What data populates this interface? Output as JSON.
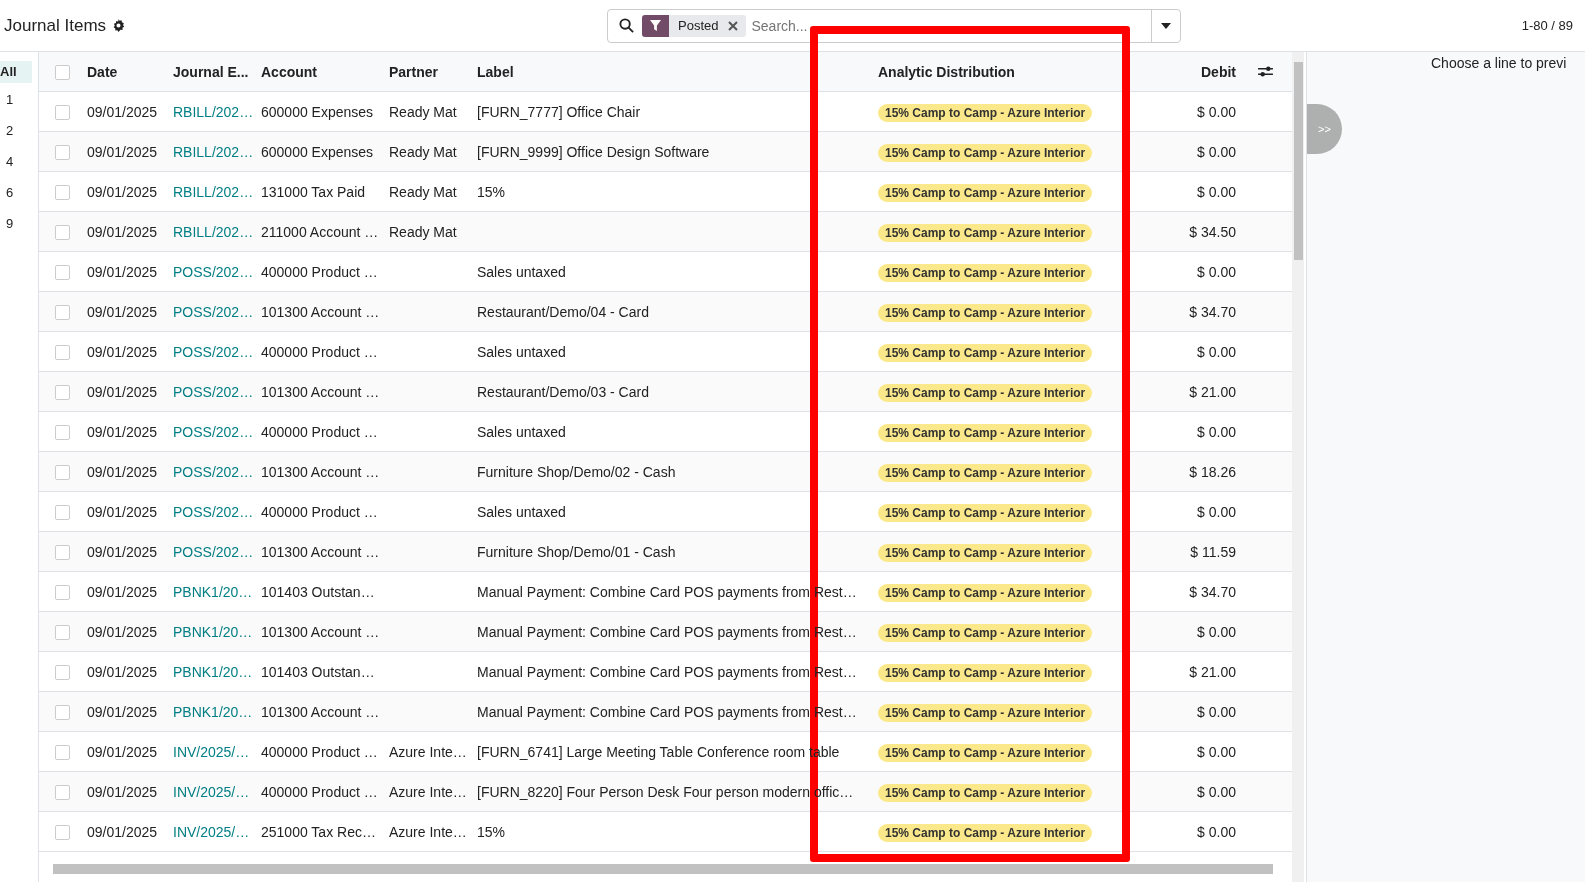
{
  "title": "Journal Items",
  "search": {
    "facet": "Posted",
    "placeholder": "Search..."
  },
  "pager": "1-80 / 89",
  "groups": [
    {
      "label": "All",
      "selected": true
    },
    {
      "label": "1",
      "selected": false
    },
    {
      "label": "2",
      "selected": false
    },
    {
      "label": "4",
      "selected": false
    },
    {
      "label": "6",
      "selected": false
    },
    {
      "label": "9",
      "selected": false
    }
  ],
  "select_all_checked": false,
  "columns": [
    "Date",
    "Journal E...",
    "Account",
    "Partner",
    "Label",
    "Analytic Distribution",
    "Debit"
  ],
  "rows": [
    {
      "checked": false,
      "date": "09/01/2025",
      "journal": "RBILL/202…",
      "account": "600000 Expenses",
      "partner": "Ready Mat",
      "label": "[FURN_7777] Office Chair",
      "analytic": "15% Camp to Camp - Azure Interior",
      "debit": "$ 0.00"
    },
    {
      "checked": false,
      "date": "09/01/2025",
      "journal": "RBILL/202…",
      "account": "600000 Expenses",
      "partner": "Ready Mat",
      "label": "[FURN_9999] Office Design Software",
      "analytic": "15% Camp to Camp - Azure Interior",
      "debit": "$ 0.00"
    },
    {
      "checked": false,
      "date": "09/01/2025",
      "journal": "RBILL/202…",
      "account": "131000 Tax Paid",
      "partner": "Ready Mat",
      "label": "15%",
      "analytic": "15% Camp to Camp - Azure Interior",
      "debit": "$ 0.00"
    },
    {
      "checked": false,
      "date": "09/01/2025",
      "journal": "RBILL/202…",
      "account": "211000 Account …",
      "partner": "Ready Mat",
      "label": "",
      "analytic": "15% Camp to Camp - Azure Interior",
      "debit": "$ 34.50"
    },
    {
      "checked": false,
      "date": "09/01/2025",
      "journal": "POSS/202…",
      "account": "400000 Product …",
      "partner": "",
      "label": "Sales untaxed",
      "analytic": "15% Camp to Camp - Azure Interior",
      "debit": "$ 0.00"
    },
    {
      "checked": false,
      "date": "09/01/2025",
      "journal": "POSS/202…",
      "account": "101300 Account …",
      "partner": "",
      "label": "Restaurant/Demo/04 - Card",
      "analytic": "15% Camp to Camp - Azure Interior",
      "debit": "$ 34.70"
    },
    {
      "checked": false,
      "date": "09/01/2025",
      "journal": "POSS/202…",
      "account": "400000 Product …",
      "partner": "",
      "label": "Sales untaxed",
      "analytic": "15% Camp to Camp - Azure Interior",
      "debit": "$ 0.00"
    },
    {
      "checked": false,
      "date": "09/01/2025",
      "journal": "POSS/202…",
      "account": "101300 Account …",
      "partner": "",
      "label": "Restaurant/Demo/03 - Card",
      "analytic": "15% Camp to Camp - Azure Interior",
      "debit": "$ 21.00"
    },
    {
      "checked": false,
      "date": "09/01/2025",
      "journal": "POSS/202…",
      "account": "400000 Product …",
      "partner": "",
      "label": "Sales untaxed",
      "analytic": "15% Camp to Camp - Azure Interior",
      "debit": "$ 0.00"
    },
    {
      "checked": false,
      "date": "09/01/2025",
      "journal": "POSS/202…",
      "account": "101300 Account …",
      "partner": "",
      "label": "Furniture Shop/Demo/02 - Cash",
      "analytic": "15% Camp to Camp - Azure Interior",
      "debit": "$ 18.26"
    },
    {
      "checked": false,
      "date": "09/01/2025",
      "journal": "POSS/202…",
      "account": "400000 Product …",
      "partner": "",
      "label": "Sales untaxed",
      "analytic": "15% Camp to Camp - Azure Interior",
      "debit": "$ 0.00"
    },
    {
      "checked": false,
      "date": "09/01/2025",
      "journal": "POSS/202…",
      "account": "101300 Account …",
      "partner": "",
      "label": "Furniture Shop/Demo/01 - Cash",
      "analytic": "15% Camp to Camp - Azure Interior",
      "debit": "$ 11.59"
    },
    {
      "checked": false,
      "date": "09/01/2025",
      "journal": "PBNK1/20…",
      "account": "101403 Outstan…",
      "partner": "",
      "label": "Manual Payment: Combine Card POS payments from Rest…",
      "analytic": "15% Camp to Camp - Azure Interior",
      "debit": "$ 34.70"
    },
    {
      "checked": false,
      "date": "09/01/2025",
      "journal": "PBNK1/20…",
      "account": "101300 Account …",
      "partner": "",
      "label": "Manual Payment: Combine Card POS payments from Rest…",
      "analytic": "15% Camp to Camp - Azure Interior",
      "debit": "$ 0.00"
    },
    {
      "checked": false,
      "date": "09/01/2025",
      "journal": "PBNK1/20…",
      "account": "101403 Outstan…",
      "partner": "",
      "label": "Manual Payment: Combine Card POS payments from Rest…",
      "analytic": "15% Camp to Camp - Azure Interior",
      "debit": "$ 21.00"
    },
    {
      "checked": false,
      "date": "09/01/2025",
      "journal": "PBNK1/20…",
      "account": "101300 Account …",
      "partner": "",
      "label": "Manual Payment: Combine Card POS payments from Rest…",
      "analytic": "15% Camp to Camp - Azure Interior",
      "debit": "$ 0.00"
    },
    {
      "checked": false,
      "date": "09/01/2025",
      "journal": "INV/2025/…",
      "account": "400000 Product …",
      "partner": "Azure Inte…",
      "label": "[FURN_6741] Large Meeting Table Conference room table",
      "analytic": "15% Camp to Camp - Azure Interior",
      "debit": "$ 0.00"
    },
    {
      "checked": false,
      "date": "09/01/2025",
      "journal": "INV/2025/…",
      "account": "400000 Product …",
      "partner": "Azure Inte…",
      "label": "[FURN_8220] Four Person Desk Four person modern offic…",
      "analytic": "15% Camp to Camp - Azure Interior",
      "debit": "$ 0.00"
    },
    {
      "checked": false,
      "date": "09/01/2025",
      "journal": "INV/2025/…",
      "account": "251000 Tax Rec…",
      "partner": "Azure Inte…",
      "label": "15%",
      "analytic": "15% Camp to Camp - Azure Interior",
      "debit": "$ 0.00"
    }
  ],
  "preview": "Choose a line to previ",
  "toggle": ">>"
}
